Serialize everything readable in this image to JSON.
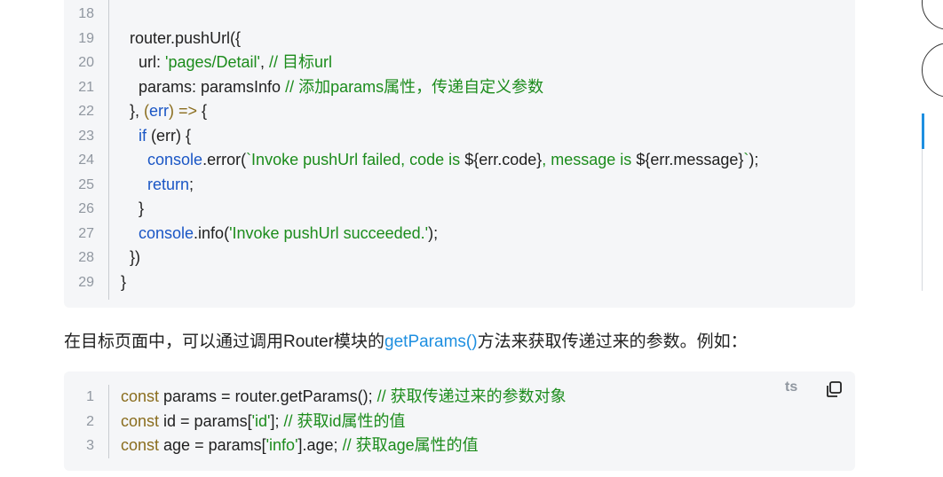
{
  "block1": {
    "lines": [
      {
        "n": "18",
        "tokens": []
      },
      {
        "n": "19",
        "tokens": [
          [
            "pl",
            "  router.pushUrl({"
          ]
        ]
      },
      {
        "n": "20",
        "tokens": [
          [
            "pl",
            "    url: "
          ],
          [
            "str",
            "'pages/Detail'"
          ],
          [
            "pl",
            ", "
          ],
          [
            "cm",
            "// 目标url"
          ]
        ]
      },
      {
        "n": "21",
        "tokens": [
          [
            "pl",
            "    params: paramsInfo "
          ],
          [
            "cm",
            "// 添加params属性，传递自定义参数"
          ]
        ]
      },
      {
        "n": "22",
        "tokens": [
          [
            "pl",
            "  }, "
          ],
          [
            "arrow",
            "("
          ],
          [
            "kw2",
            "err"
          ],
          [
            "arrow",
            ") => "
          ],
          [
            "pl",
            "{"
          ]
        ]
      },
      {
        "n": "23",
        "tokens": [
          [
            "kw2",
            "    if"
          ],
          [
            "pl",
            " (err) {"
          ]
        ]
      },
      {
        "n": "24",
        "tokens": [
          [
            "obj",
            "      console"
          ],
          [
            "pl",
            ".error("
          ],
          [
            "tpl",
            "`Invoke pushUrl failed, code is "
          ],
          [
            "pl",
            "${err.code}"
          ],
          [
            "tpl",
            ", message is "
          ],
          [
            "pl",
            "${err.message}"
          ],
          [
            "tpl",
            "`"
          ],
          [
            "pl",
            ");"
          ]
        ]
      },
      {
        "n": "25",
        "tokens": [
          [
            "kw2",
            "      return"
          ],
          [
            "pl",
            ";"
          ]
        ]
      },
      {
        "n": "26",
        "tokens": [
          [
            "pl",
            "    }"
          ]
        ]
      },
      {
        "n": "27",
        "tokens": [
          [
            "obj",
            "    console"
          ],
          [
            "pl",
            ".info("
          ],
          [
            "str",
            "'Invoke pushUrl succeeded.'"
          ],
          [
            "pl",
            ");"
          ]
        ]
      },
      {
        "n": "28",
        "tokens": [
          [
            "pl",
            "  })"
          ]
        ]
      },
      {
        "n": "29",
        "tokens": [
          [
            "pl",
            "}"
          ]
        ]
      }
    ]
  },
  "paragraph": {
    "before": "在目标页面中，可以通过调用Router模块的",
    "link": "getParams()",
    "after": "方法来获取传递过来的参数。例如："
  },
  "block2": {
    "lang": "ts",
    "lines": [
      {
        "n": "1",
        "tokens": [
          [
            "kw",
            "const"
          ],
          [
            "pl",
            " params = router.getParams(); "
          ],
          [
            "cm",
            "// 获取传递过来的参数对象"
          ]
        ]
      },
      {
        "n": "2",
        "tokens": [
          [
            "kw",
            "const"
          ],
          [
            "pl",
            " id = params["
          ],
          [
            "str",
            "'id'"
          ],
          [
            "pl",
            "]; "
          ],
          [
            "cm",
            "// 获取id属性的值"
          ]
        ]
      },
      {
        "n": "3",
        "tokens": [
          [
            "kw",
            "const"
          ],
          [
            "pl",
            " age = params["
          ],
          [
            "str",
            "'info'"
          ],
          [
            "pl",
            "].age; "
          ],
          [
            "cm",
            "// 获取age属性的值"
          ]
        ]
      }
    ]
  }
}
